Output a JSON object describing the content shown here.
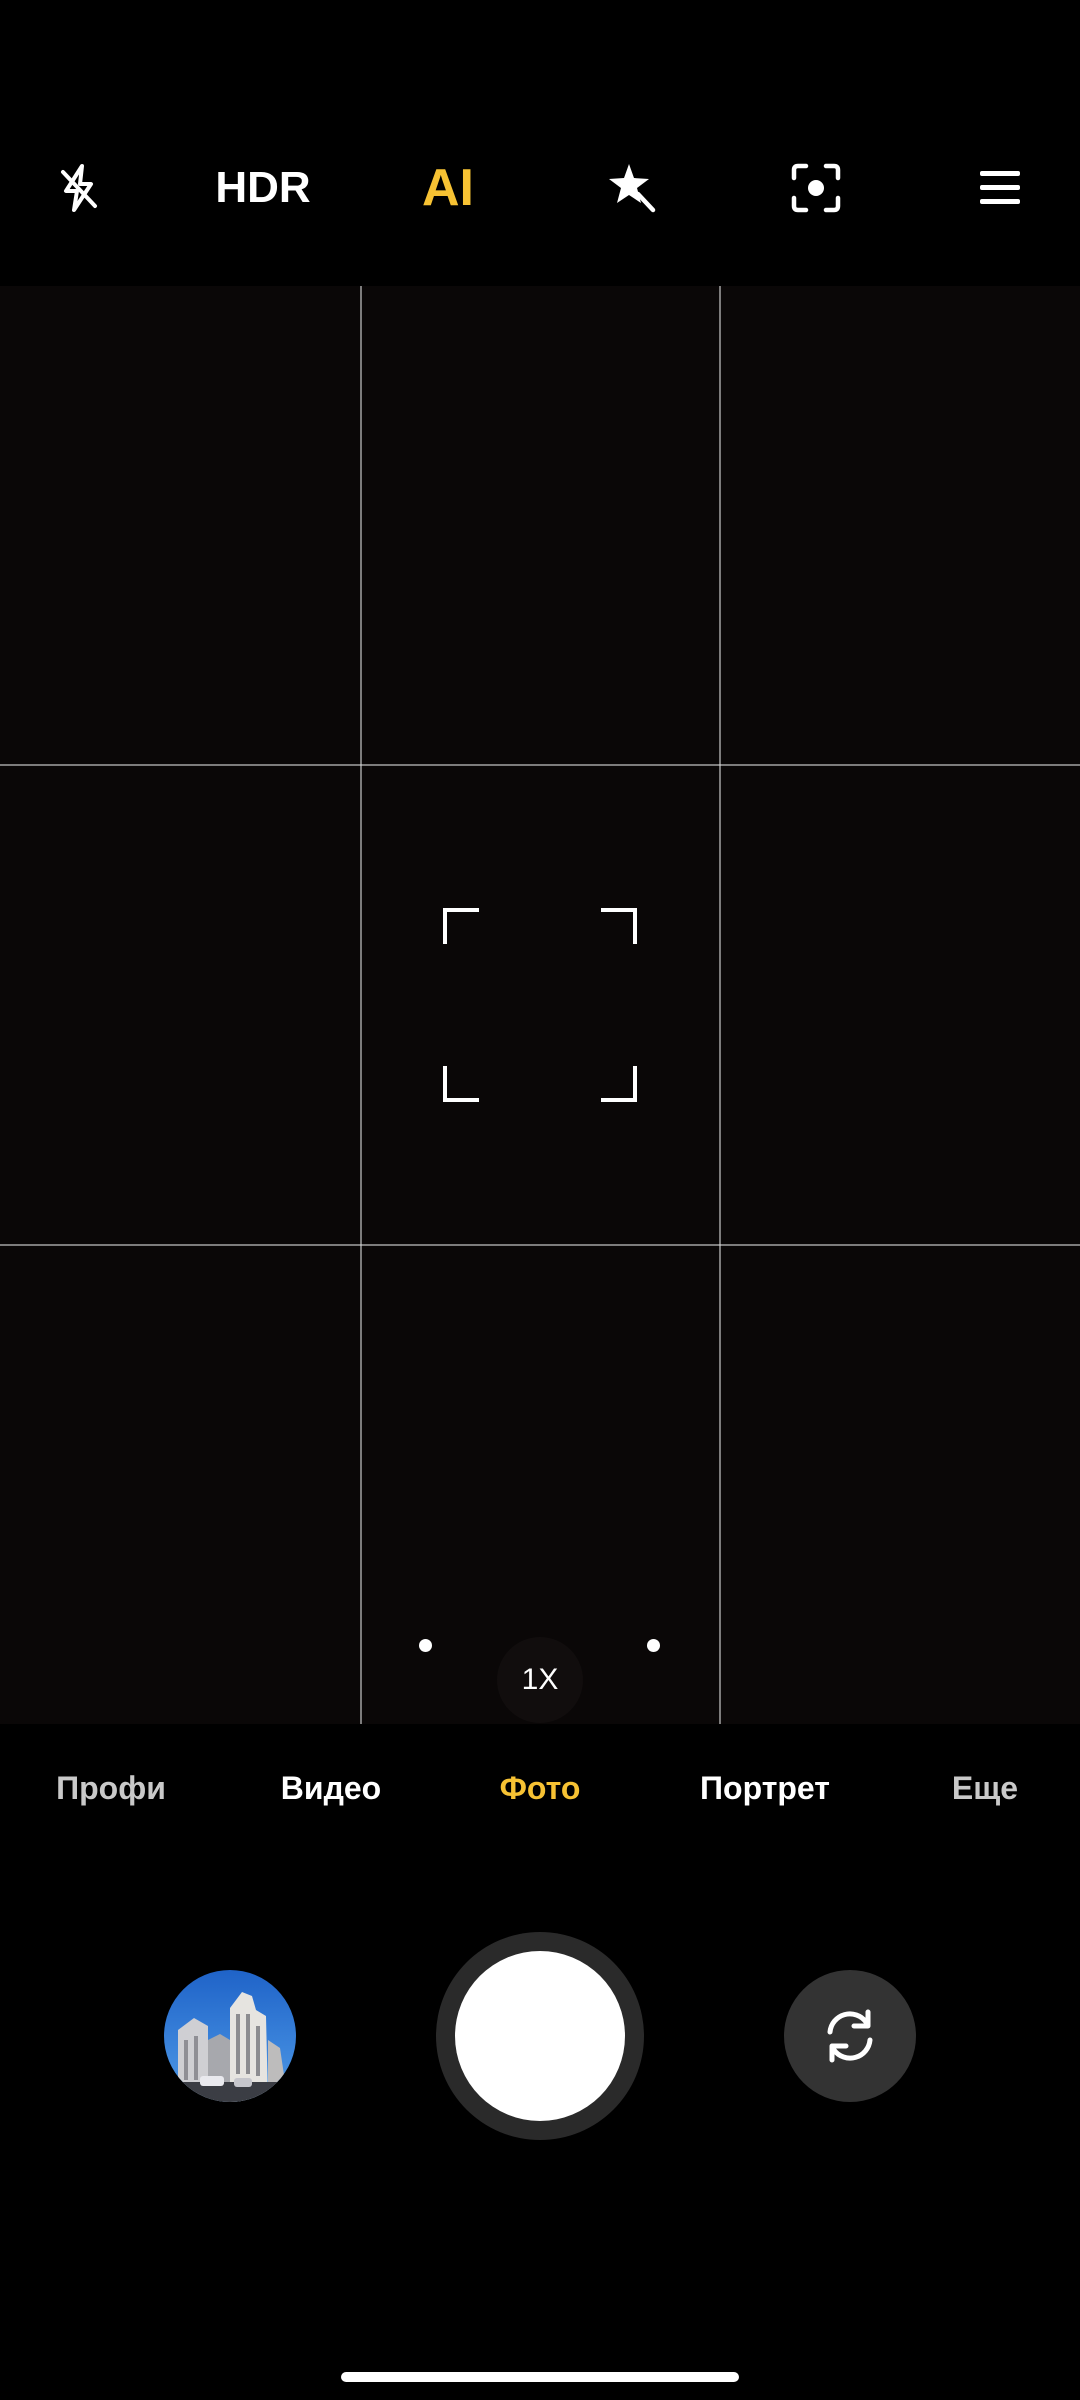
{
  "top_bar": {
    "items": [
      {
        "icon": "flash-off-icon"
      },
      {
        "label": "HDR"
      },
      {
        "label": "AI",
        "color": "#f7c233"
      },
      {
        "icon": "beautify-sparkle-icon"
      },
      {
        "icon": "lens-scan-icon"
      },
      {
        "icon": "menu-icon"
      }
    ]
  },
  "viewfinder": {
    "grid": "on",
    "zoom_label": "1X"
  },
  "modes": {
    "items": [
      "Профи",
      "Видео",
      "Фото",
      "Портрет",
      "Еще"
    ],
    "active": "Фото",
    "active_color": "#f7c233"
  },
  "controls": {
    "gallery": "gallery-thumbnail",
    "shutter": "shutter-button",
    "switch": "switch-camera-icon"
  }
}
